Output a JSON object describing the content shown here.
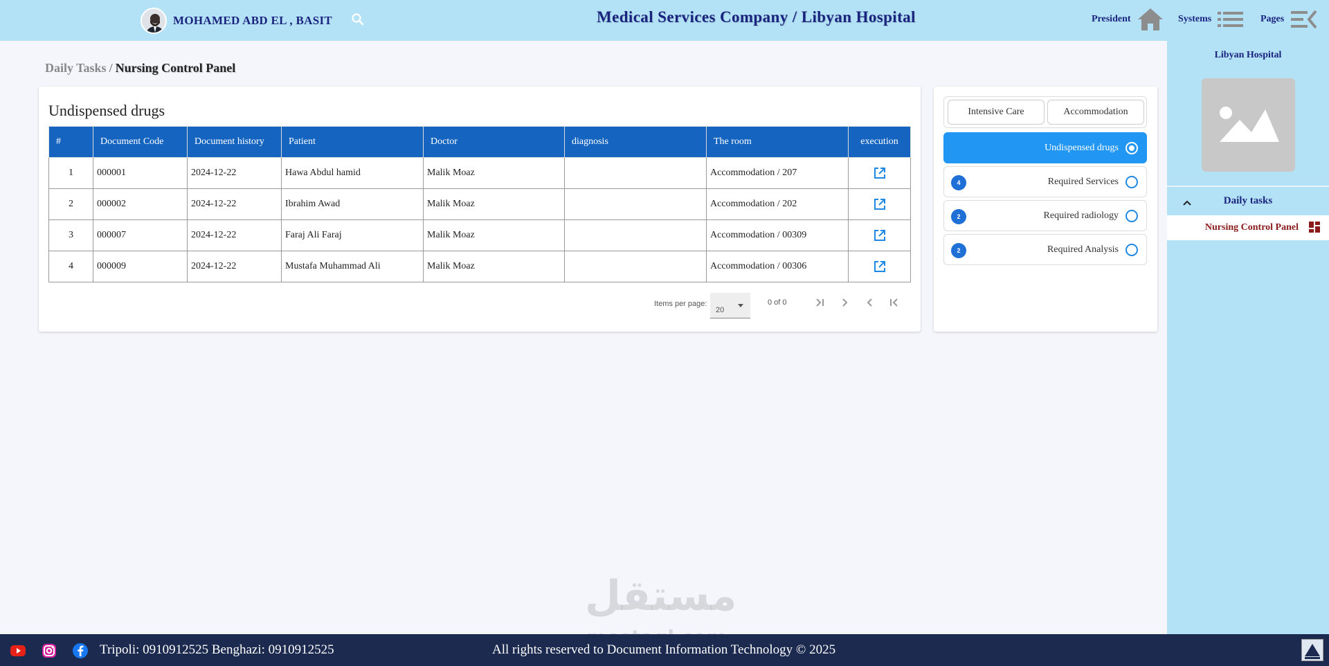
{
  "header": {
    "user_name": "MOHAMED ABD EL , BASIT",
    "app_title": "Medical Services Company / Libyan Hospital",
    "nav": {
      "president": "President",
      "systems": "Systems",
      "pages": "Pages"
    },
    "icons": [
      "search-icon",
      "home-icon",
      "list-icon",
      "menu-icon"
    ]
  },
  "breadcrumb": {
    "parent": "Daily Tasks",
    "separator": "/",
    "current": "Nursing Control Panel"
  },
  "main": {
    "title": "Undispensed drugs",
    "columns": [
      "#",
      "Document Code",
      "Document history",
      "Patient",
      "Doctor",
      "diagnosis",
      "The room",
      "execution"
    ],
    "rows": [
      {
        "num": "1",
        "code": "000001",
        "date": "2024-12-22",
        "patient": "Hawa Abdul hamid",
        "doctor": "Malik Moaz",
        "diagnosis": "",
        "room": "Accommodation / 207"
      },
      {
        "num": "2",
        "code": "000002",
        "date": "2024-12-22",
        "patient": "Ibrahim Awad",
        "doctor": "Malik Moaz",
        "diagnosis": "",
        "room": "Accommodation / 202"
      },
      {
        "num": "3",
        "code": "000007",
        "date": "2024-12-22",
        "patient": "Faraj Ali Faraj",
        "doctor": "Malik Moaz",
        "diagnosis": "",
        "room": "Accommodation / 00309"
      },
      {
        "num": "4",
        "code": "000009",
        "date": "2024-12-22",
        "patient": "Mustafa Muhammad Ali",
        "doctor": "Malik Moaz",
        "diagnosis": "",
        "room": "Accommodation / 00306"
      }
    ],
    "paginator": {
      "items_per_page_label": "Items per page:",
      "items_per_page_value": "20",
      "range": "0 of 0"
    }
  },
  "filters": {
    "tabs": [
      "Intensive Care",
      "Accommodation"
    ],
    "options": [
      {
        "label": "Undispensed drugs",
        "badge": "",
        "active": true
      },
      {
        "label": "Required Services",
        "badge": "4",
        "active": false
      },
      {
        "label": "Required radiology",
        "badge": "2",
        "active": false
      },
      {
        "label": "Required Analysis",
        "badge": "2",
        "active": false
      }
    ]
  },
  "sidebar": {
    "title": "Libyan Hospital",
    "section": "Daily tasks",
    "item": "Nursing Control Panel"
  },
  "footer": {
    "phones": "Tripoli: 0910912525  Benghazi: 0910912525",
    "copyright": "All rights reserved to Document Information Technology © 2025"
  },
  "watermark": {
    "arabic": "مستقل",
    "latin": "mostaql.com"
  },
  "colors": {
    "header_bg": "#b3e2f7",
    "table_header_bg": "#1565c0",
    "active_option_bg": "#2196f3",
    "footer_bg": "#1b2a4e",
    "title_text": "#1a237e",
    "sidebar_item_text": "#8b1a1a"
  }
}
